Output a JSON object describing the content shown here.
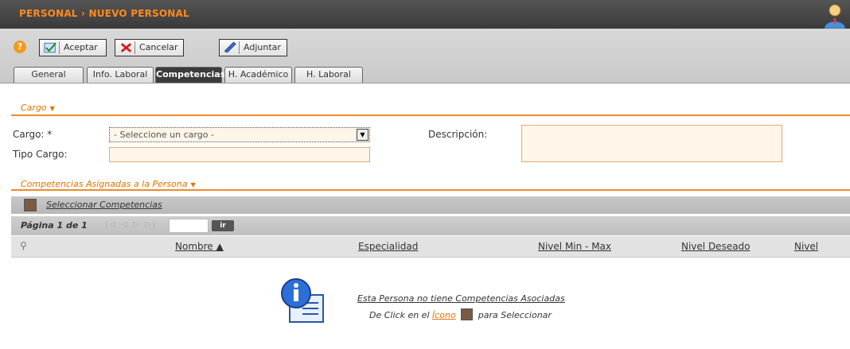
{
  "header": {
    "title": "PERSONAL › NUEVO PERSONAL",
    "user_icon": "user-avatar-icon"
  },
  "toolbar": {
    "help_icon": "question-icon",
    "help_glyph": "?",
    "accept_label": "Aceptar",
    "cancel_label": "Cancelar",
    "attach_label": "Adjuntar"
  },
  "tabs": [
    {
      "label": "General",
      "active": false
    },
    {
      "label": "Info. Laboral",
      "active": false
    },
    {
      "label": "Competencias",
      "active": true
    },
    {
      "label": "H. Académico",
      "active": false
    },
    {
      "label": "H. Laboral",
      "active": false
    }
  ],
  "cargo_section": {
    "title": "Cargo",
    "caret": "▼",
    "cargo_label": "Cargo: *",
    "cargo_value": "- Seleccione un cargo -",
    "select_arrow": "▼",
    "tipo_cargo_label": "Tipo Cargo:",
    "tipo_cargo_value": "",
    "descripcion_label": "Descripción:",
    "descripcion_value": ""
  },
  "competencias_section": {
    "title": "Competencias Asignadas a la Persona",
    "caret": "▼",
    "select_link": "Seleccionar Competencias",
    "pager_text": "Página 1 de 1",
    "pager_nav": "|◁ ◁ ▷ ▷|",
    "pager_button": "ir",
    "filter_glyph": "⚲",
    "columns": [
      "Nombre ▲",
      "Especialidad",
      "Nivel Min - Max",
      "Nivel Deseado",
      "Nivel"
    ],
    "empty_message": "Esta Persona no tiene Competencias Asociadas",
    "hint_prefix": "De Click en el",
    "hint_link": "Ícono",
    "hint_suffix": "para Seleccionar"
  },
  "colors": {
    "accent": "#f08a2c",
    "header_bg": "#444444",
    "field_bg": "#fff6ea"
  }
}
